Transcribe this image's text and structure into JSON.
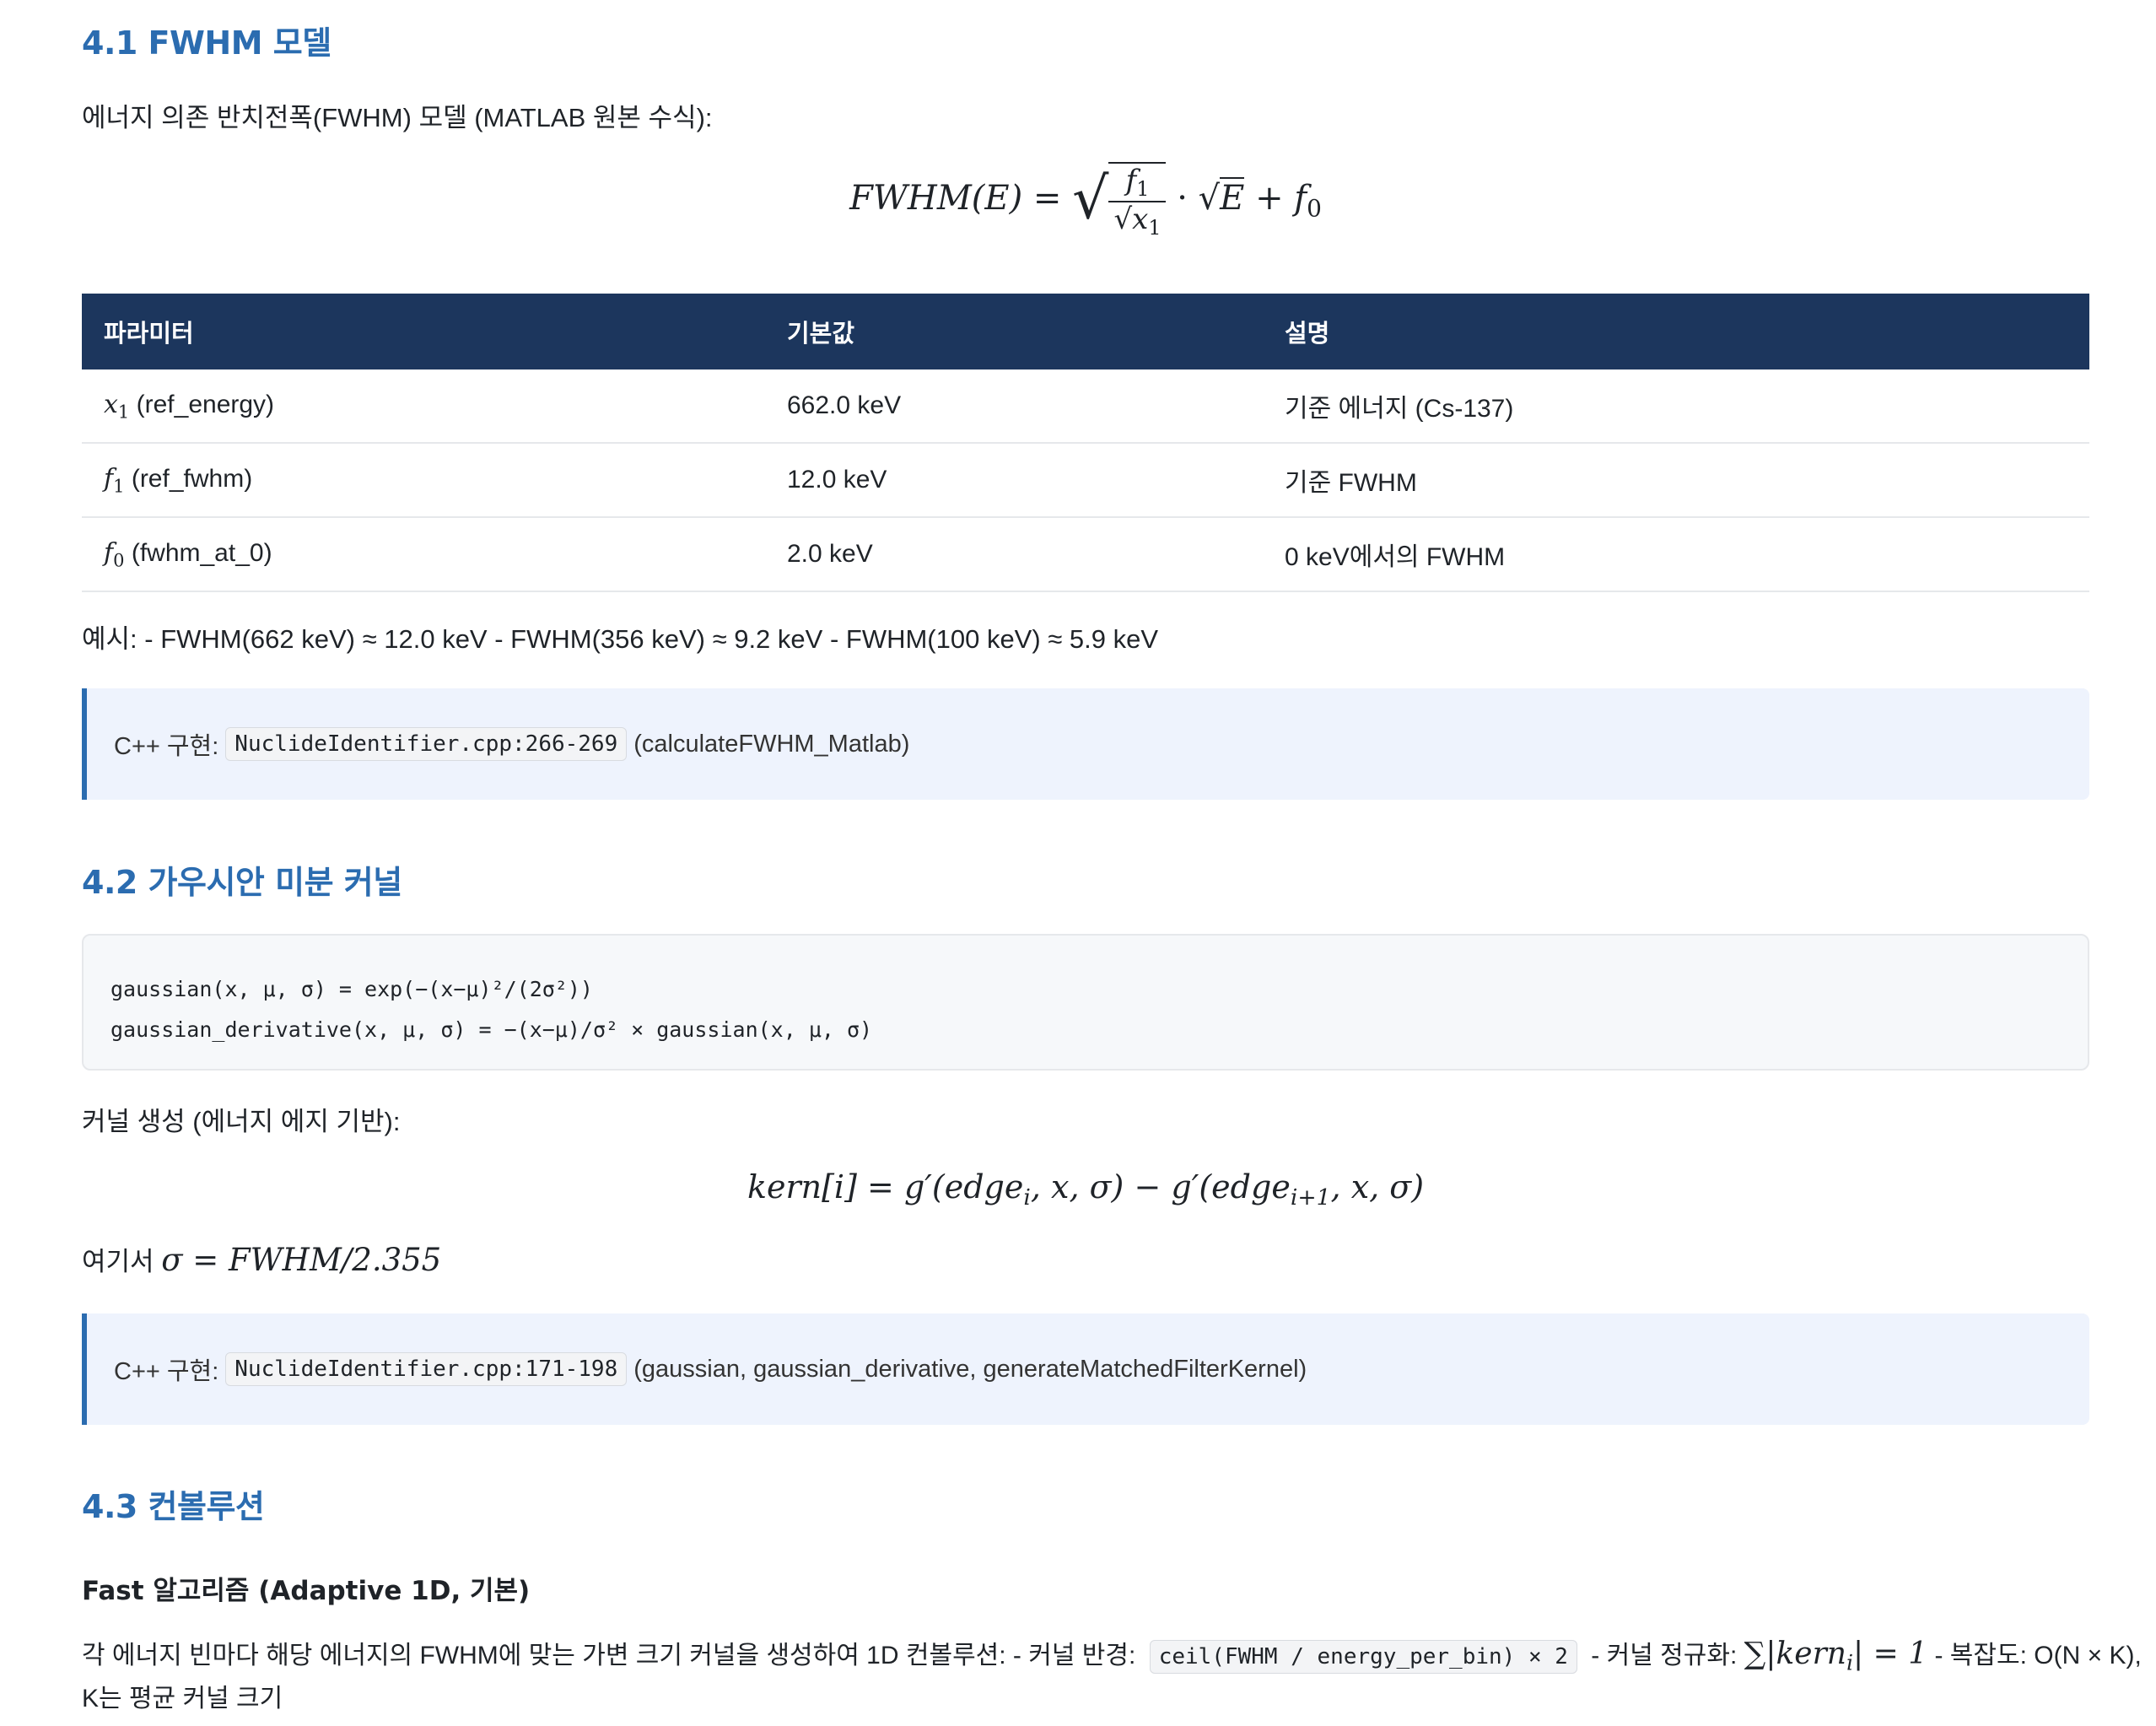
{
  "section_41": {
    "heading": "4.1 FWHM 모델",
    "intro": "에너지 의존 반치전폭(FWHM) 모델 (MATLAB 원본 수식):",
    "formula": {
      "lhs": "FWHM(E)",
      "eq": "=",
      "num": "f",
      "num_sub": "1",
      "den": "x",
      "den_sub": "1",
      "mid": "·",
      "sqrt_arg": "E",
      "plus": "+",
      "tail": "f",
      "tail_sub": "0"
    },
    "table": {
      "headers": [
        "파라미터",
        "기본값",
        "설명"
      ],
      "rows": [
        {
          "sym": "x",
          "sub": "1",
          "name": "(ref_energy)",
          "value": "662.0 keV",
          "desc": "기준 에너지 (Cs-137)"
        },
        {
          "sym": "f",
          "sub": "1",
          "name": "(ref_fwhm)",
          "value": "12.0 keV",
          "desc": "기준 FWHM"
        },
        {
          "sym": "f",
          "sub": "0",
          "name": "(fwhm_at_0)",
          "value": "2.0 keV",
          "desc": "0 keV에서의 FWHM"
        }
      ]
    },
    "example": "예시: - FWHM(662 keV) ≈ 12.0 keV - FWHM(356 keV) ≈ 9.2 keV - FWHM(100 keV) ≈ 5.9 keV",
    "note": {
      "prefix": "C++ 구현:",
      "code": "NuclideIdentifier.cpp:266-269",
      "suffix": "(calculateFWHM_Matlab)"
    }
  },
  "section_42": {
    "heading": "4.2 가우시안 미분 커널",
    "code_lines": [
      "gaussian(x, μ, σ) = exp(−(x−μ)²/(2σ²))",
      "gaussian_derivative(x, μ, σ) = −(x−μ)/σ² × gaussian(x, μ, σ)"
    ],
    "kernel_intro": "커널 생성 (에너지 에지 기반):",
    "kernel_formula": {
      "lhs": "kern[i]",
      "eq": "=",
      "g1": "g′(edge",
      "g1_sub": "i",
      "g1_tail": ", x, σ)",
      "minus": "−",
      "g2": "g′(edge",
      "g2_sub": "i+1",
      "g2_tail": ", x, σ)"
    },
    "sigma_prefix": "여기서",
    "sigma_formula": "σ = FWHM/2.355",
    "note": {
      "prefix": "C++ 구현:",
      "code": "NuclideIdentifier.cpp:171-198",
      "suffix": "(gaussian, gaussian_derivative, generateMatchedFilterKernel)"
    }
  },
  "section_43": {
    "heading": "4.3 컨볼루션",
    "subheading": "Fast 알고리즘 (Adaptive 1D, 기본)",
    "para_a": "각 에너지 빈마다 해당 에너지의 FWHM에 맞는 가변 크기 커널을 생성하여 1D 컨볼루션: - 커널 반경:",
    "para_code": "ceil(FWHM / energy_per_bin) × 2",
    "para_b": "- 커널 정규화:",
    "para_math": "∑|kern",
    "para_math_sub": "i",
    "para_math_tail": "| = 1",
    "para_c": "- 복잡도: O(N × K),",
    "para_line2": "K는 평균 커널 크기"
  }
}
